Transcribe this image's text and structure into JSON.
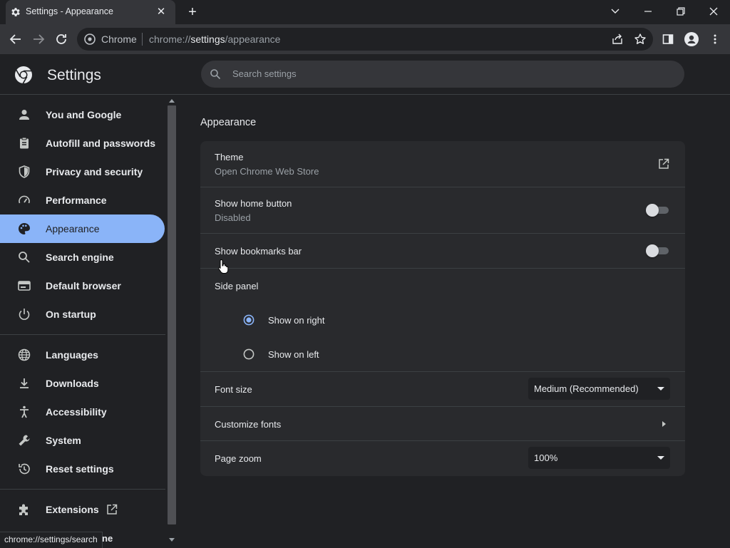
{
  "window": {
    "tab_title": "Settings - Appearance",
    "tab_close": "✕",
    "new_tab": "+"
  },
  "toolbar": {
    "site_label": "Chrome",
    "url_scheme": "chrome://",
    "url_host": "settings",
    "url_path": "/appearance"
  },
  "header": {
    "title": "Settings",
    "search_placeholder": "Search settings"
  },
  "sidebar": {
    "items": [
      {
        "label": "You and Google",
        "icon": "person-icon"
      },
      {
        "label": "Autofill and passwords",
        "icon": "clipboard-icon"
      },
      {
        "label": "Privacy and security",
        "icon": "shield-icon"
      },
      {
        "label": "Performance",
        "icon": "speedometer-icon"
      },
      {
        "label": "Appearance",
        "icon": "palette-icon",
        "active": true
      },
      {
        "label": "Search engine",
        "icon": "search-icon"
      },
      {
        "label": "Default browser",
        "icon": "browser-window-icon"
      },
      {
        "label": "On startup",
        "icon": "power-icon"
      },
      {
        "label": "Languages",
        "icon": "globe-icon"
      },
      {
        "label": "Downloads",
        "icon": "download-icon"
      },
      {
        "label": "Accessibility",
        "icon": "accessibility-icon"
      },
      {
        "label": "System",
        "icon": "wrench-icon"
      },
      {
        "label": "Reset settings",
        "icon": "history-icon"
      },
      {
        "label": "Extensions",
        "icon": "puzzle-icon"
      }
    ]
  },
  "status_bar": "chrome://settings/search",
  "status_bar_overflow": "ne",
  "main": {
    "section_title": "Appearance",
    "theme": {
      "label": "Theme",
      "sub": "Open Chrome Web Store"
    },
    "home_button": {
      "label": "Show home button",
      "sub": "Disabled",
      "enabled": false
    },
    "bookmarks_bar": {
      "label": "Show bookmarks bar",
      "enabled": false
    },
    "side_panel": {
      "label": "Side panel",
      "options": [
        {
          "label": "Show on right",
          "selected": true
        },
        {
          "label": "Show on left",
          "selected": false
        }
      ]
    },
    "font_size": {
      "label": "Font size",
      "value": "Medium (Recommended)"
    },
    "customize_fonts": {
      "label": "Customize fonts"
    },
    "page_zoom": {
      "label": "Page zoom",
      "value": "100%"
    }
  },
  "colors": {
    "accent": "#8ab4f8",
    "background": "#202124",
    "card": "#292a2d"
  }
}
